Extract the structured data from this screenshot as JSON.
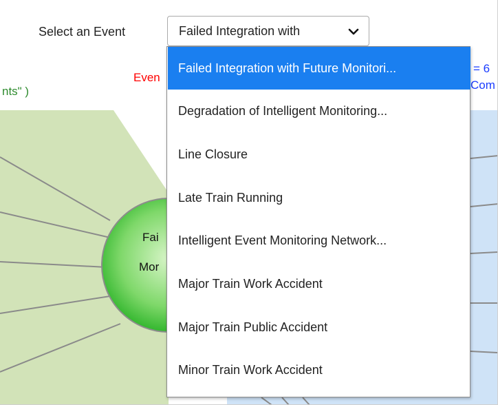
{
  "select": {
    "label": "Select an Event",
    "value": "Failed Integration with"
  },
  "dropdown": {
    "options": [
      "Failed Integration with Future Monitori...",
      "Degradation of Intelligent Monitoring...",
      "Line Closure",
      "Late Train Running",
      "Intelligent Event Monitoring Network...",
      "Major Train Work Accident",
      "Major Train Public Accident",
      "Minor Train Work Accident"
    ],
    "selected_index": 0
  },
  "background": {
    "left_legend_fragment": "nts\" )",
    "red_fragment": "Even",
    "blue_fragment_1": "= 6",
    "blue_fragment_2": "Com",
    "node_text_1": "Fai",
    "node_text_2": "Mor"
  },
  "colors": {
    "highlight": "#1a7ff0",
    "red_text": "#ff0000",
    "green_text": "#2e8b2e",
    "blue_text": "#1a3cff",
    "left_panel": "#d2e3b8",
    "right_panel": "#cfe3f7",
    "node_green": "#4fc83a"
  }
}
